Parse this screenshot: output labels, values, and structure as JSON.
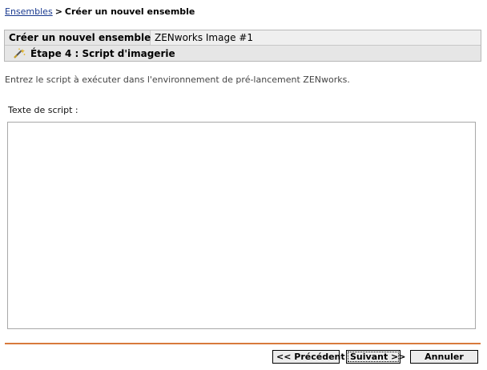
{
  "breadcrumb": {
    "parent": "Ensembles",
    "separator": ">",
    "current": "Créer un nouvel ensemble"
  },
  "header": {
    "left_label": "Créer un nouvel ensemble",
    "right_value": "ZENworks Image #1",
    "step_icon": "wizard-wand-icon",
    "step_title": "Étape 4 : Script d'imagerie"
  },
  "instructions": "Entrez le script à exécuter dans l'environnement de pré-lancement ZENworks.",
  "script": {
    "label": "Texte de script :",
    "value": ""
  },
  "buttons": {
    "previous": "<< Précédent",
    "next": "Suivant >>",
    "cancel": "Annuler"
  },
  "colors": {
    "divider": "#d87a3c",
    "header_bg": "#e6e6e6",
    "link": "#1a3a8f"
  }
}
